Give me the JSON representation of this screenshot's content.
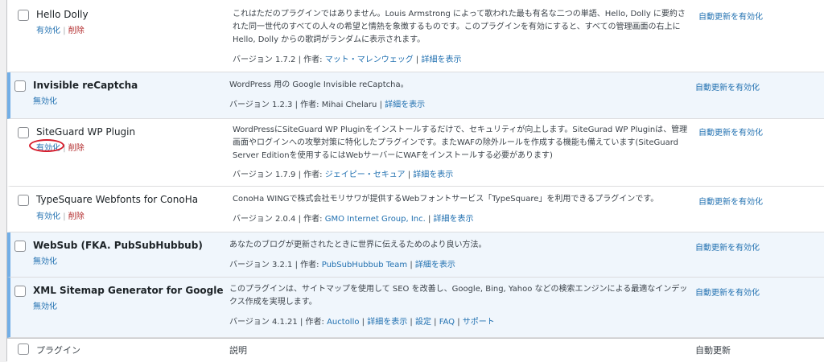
{
  "plugins": [
    {
      "name": "Hello Dolly",
      "state": "inactive",
      "action_primary": "有効化",
      "action_delete": "削除",
      "description": "これはただのプラグインではありません。Louis Armstrong によって歌われた最も有名な二つの単語、Hello, Dolly に要約された同一世代のすべての人々の希望と情熱を象徴するものです。このプラグインを有効にすると、すべての管理画面の右上に Hello, Dolly からの歌詞がランダムに表示されます。",
      "version_label": "バージョン 1.7.2",
      "author_prefix": "作者:",
      "author": "マット・マレンウェッグ",
      "details": "詳細を表示",
      "auto_update": "自動更新を有効化"
    },
    {
      "name": "Invisible reCaptcha",
      "state": "active",
      "action_primary": "無効化",
      "description": "WordPress 用の Google Invisible reCaptcha。",
      "version_label": "バージョン 1.2.3",
      "author_prefix": "作者: Mihai Chelaru",
      "details": "詳細を表示",
      "auto_update": "自動更新を有効化"
    },
    {
      "name": "SiteGuard WP Plugin",
      "state": "inactive",
      "action_primary": "有効化",
      "action_delete": "削除",
      "description": "WordPressにSiteGuard WP Pluginをインストールするだけで、セキュリティが向上します。SiteGurad WP Pluginは、管理画面やログインへの攻撃対策に特化したプラグインです。またWAFの除外ルールを作成する機能も備えています(SiteGuard Server Editionを使用するにはWebサーバーにWAFをインストールする必要があります)",
      "version_label": "バージョン 1.7.9",
      "author_prefix": "作者:",
      "author": "ジェイピー・セキュア",
      "details": "詳細を表示",
      "auto_update": "自動更新を有効化"
    },
    {
      "name": "TypeSquare Webfonts for ConoHa",
      "state": "inactive",
      "action_primary": "有効化",
      "action_delete": "削除",
      "description": "ConoHa WINGで株式会社モリサワが提供するWebフォントサービス「TypeSquare」を利用できるプラグインです。",
      "version_label": "バージョン 2.0.4",
      "author_prefix": "作者:",
      "author": "GMO Internet Group, Inc.",
      "details": "詳細を表示",
      "auto_update": "自動更新を有効化"
    },
    {
      "name": "WebSub (FKA. PubSubHubbub)",
      "state": "active",
      "action_primary": "無効化",
      "description": "あなたのブログが更新されたときに世界に伝えるためのより良い方法。",
      "version_label": "バージョン 3.2.1",
      "author_prefix": "作者:",
      "author": "PubSubHubbub Team",
      "details": "詳細を表示",
      "auto_update": "自動更新を有効化"
    },
    {
      "name": "XML Sitemap Generator for Google",
      "state": "active",
      "action_primary": "無効化",
      "description": "このプラグインは、サイトマップを使用して SEO を改善し、Google, Bing, Yahoo などの検索エンジンによる最適なインデックス作成を実現します。",
      "version_label": "バージョン 4.1.21",
      "author_prefix": "作者:",
      "author": "Auctollo",
      "details": "詳細を表示",
      "settings": "設定",
      "faq": "FAQ",
      "support": "サポート",
      "auto_update": "自動更新を有効化"
    }
  ],
  "footer": {
    "col_plugin": "プラグイン",
    "col_description": "説明",
    "col_auto_update": "自動更新"
  }
}
